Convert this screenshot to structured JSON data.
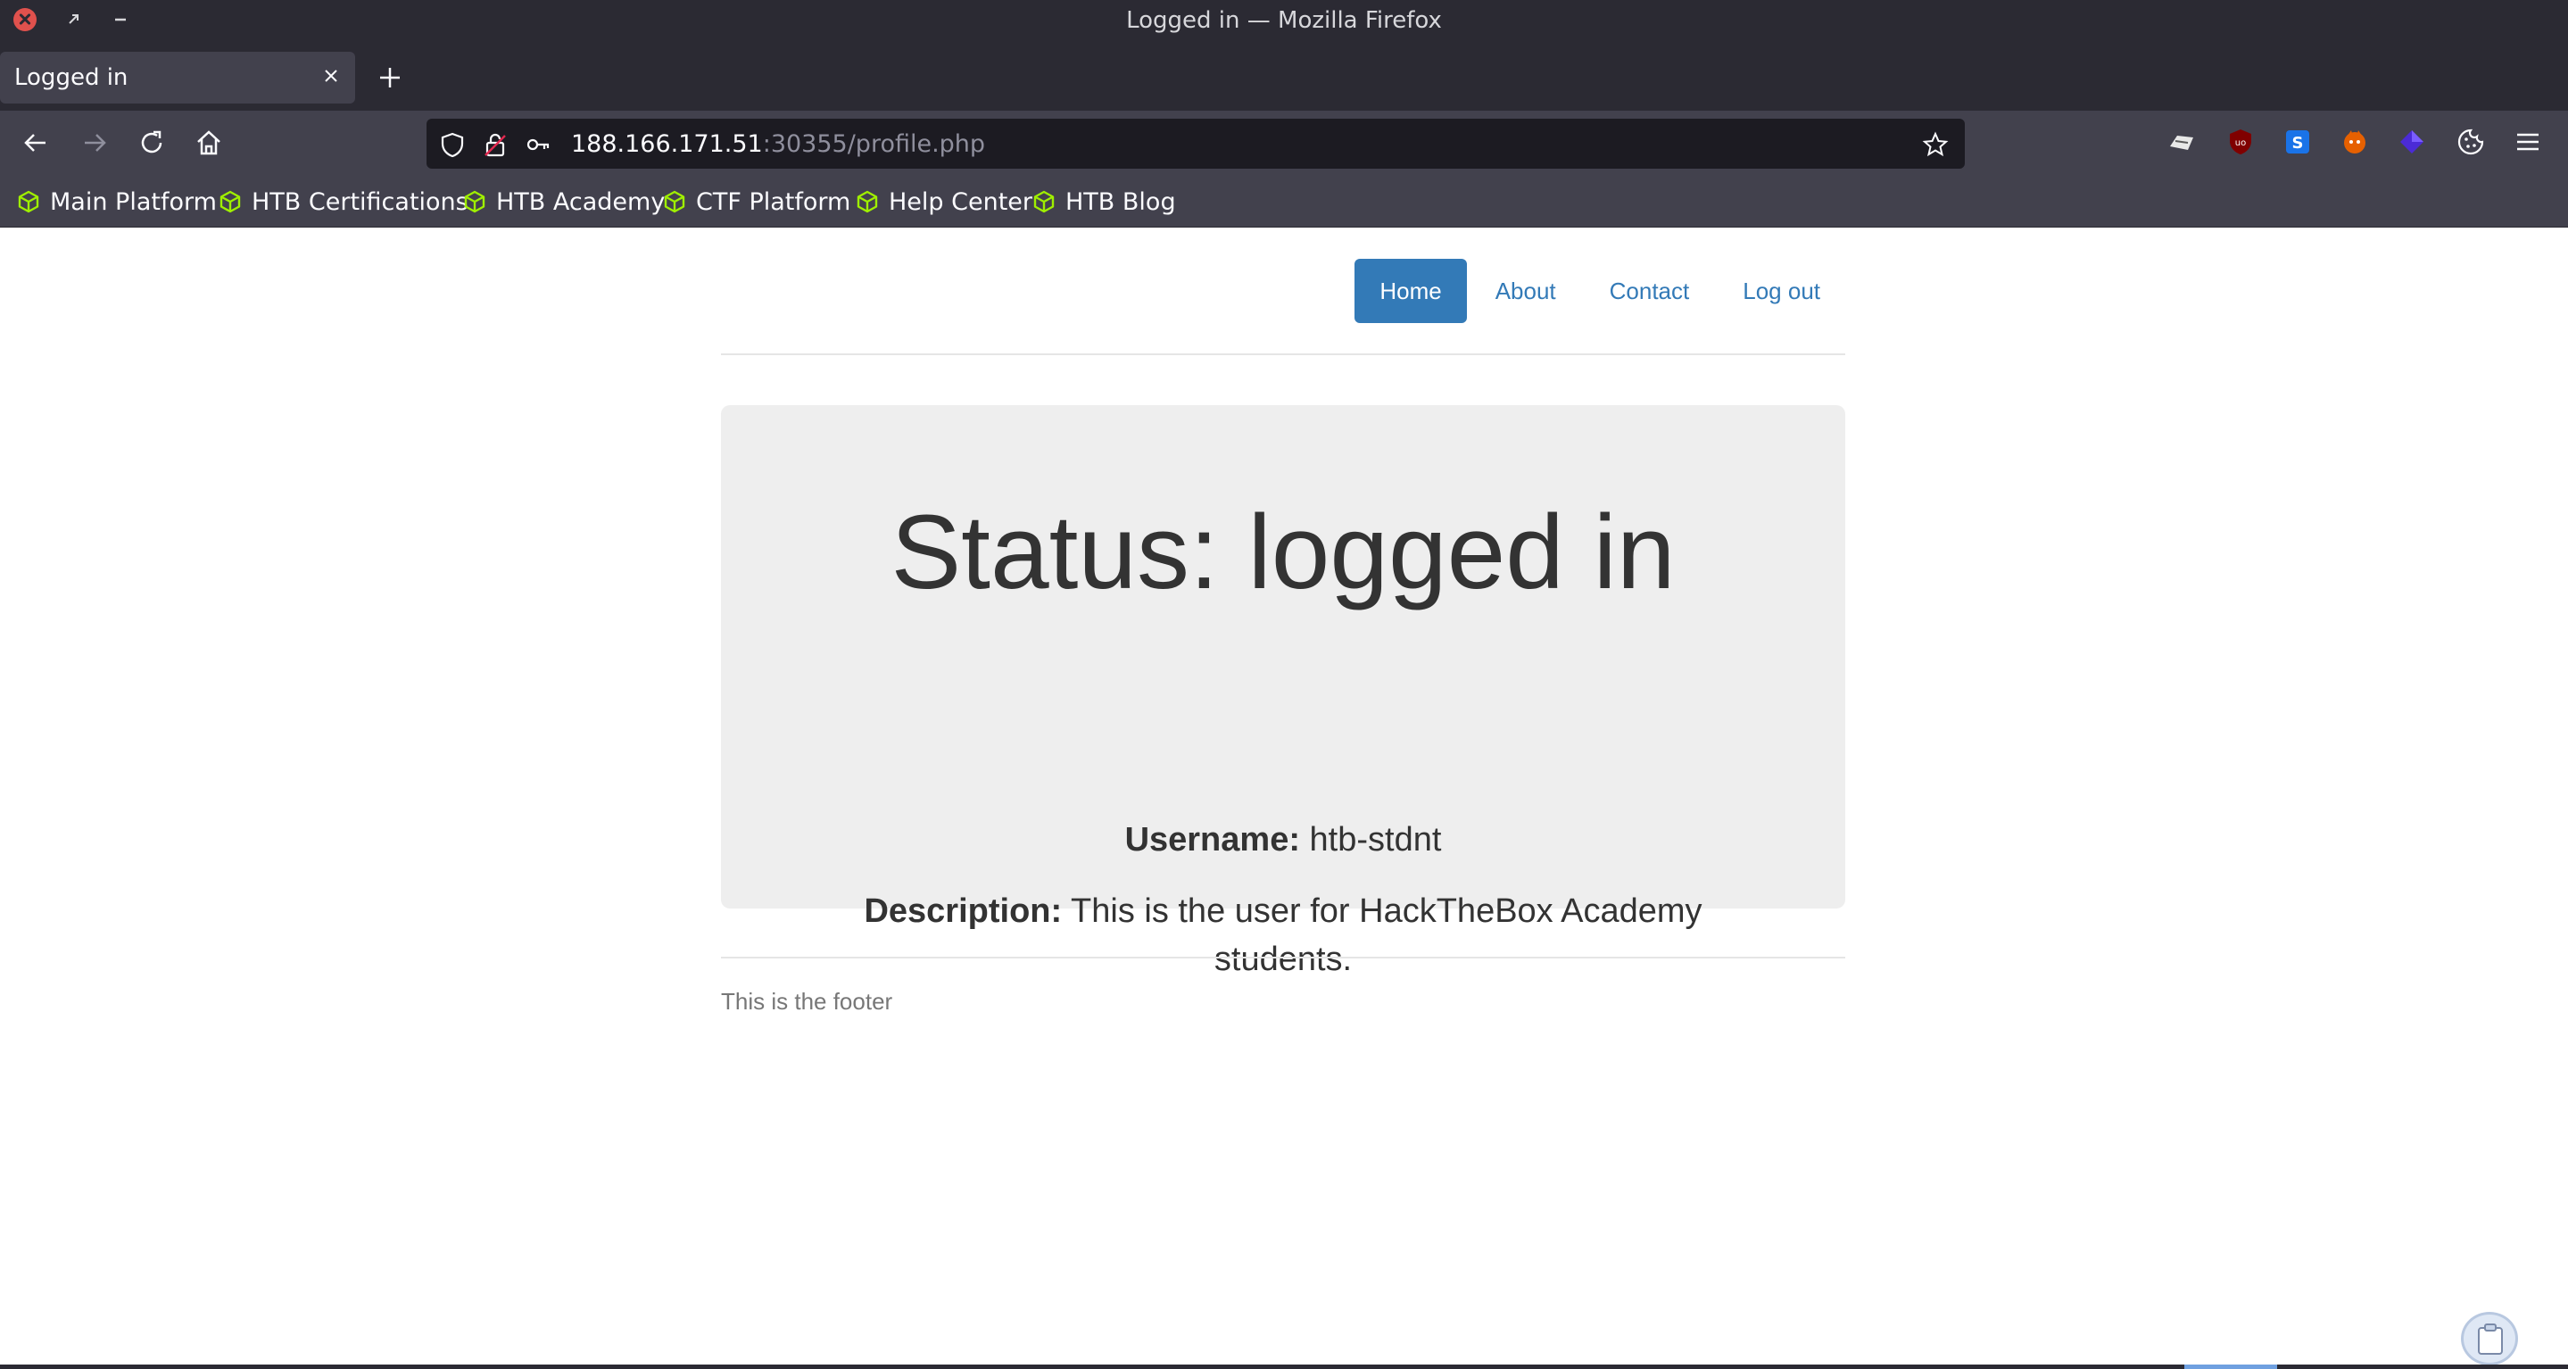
{
  "window": {
    "title": "Logged in — Mozilla Firefox"
  },
  "tabs": [
    {
      "label": "Logged in"
    }
  ],
  "urlbar": {
    "host": "188.166.171.51",
    "rest": ":30355/profile.php"
  },
  "bookmarks": [
    {
      "label": "Main Platform"
    },
    {
      "label": "HTB Certifications"
    },
    {
      "label": "HTB Academy"
    },
    {
      "label": "CTF Platform"
    },
    {
      "label": "Help Center"
    },
    {
      "label": "HTB Blog"
    }
  ],
  "site_nav": {
    "items": [
      {
        "label": "Home",
        "active": true
      },
      {
        "label": "About"
      },
      {
        "label": "Contact"
      },
      {
        "label": "Log out"
      }
    ]
  },
  "profile": {
    "title": "Status: logged in",
    "username_label": "Username:",
    "username_value": "htb-stdnt",
    "description_label": "Description:",
    "description_value": "This is the user for HackTheBox Academy students."
  },
  "footer": {
    "text": "This is the footer"
  },
  "colors": {
    "accent": "#337ab7",
    "chrome_dark": "#2b2a33",
    "chrome_mid": "#42414d",
    "jumbotron_bg": "#eeeeee",
    "htb_green": "#9fef00"
  }
}
